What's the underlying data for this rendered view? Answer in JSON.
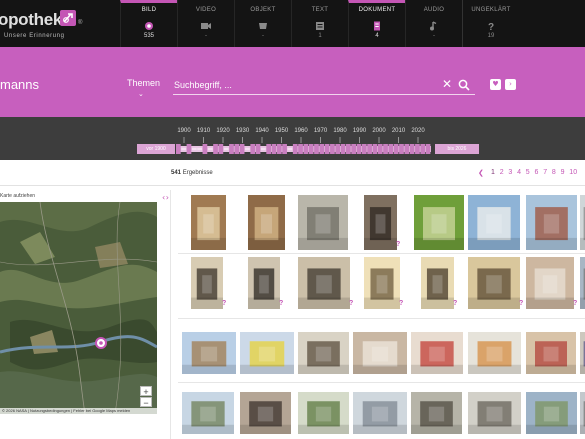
{
  "app": {
    "logo_text": "opothek",
    "logo_tagline": "Unsere Erinnerung",
    "logo_registered": "®"
  },
  "nav": {
    "tabs": [
      {
        "label": "BILD",
        "count": "535",
        "icon": "camera-icon",
        "active": true
      },
      {
        "label": "VIDEO",
        "count": "-",
        "icon": "video-icon",
        "active": false
      },
      {
        "label": "OBJEKT",
        "count": "-",
        "icon": "object-icon",
        "active": false
      },
      {
        "label": "TEXT",
        "count": "1",
        "icon": "text-icon",
        "active": false
      },
      {
        "label": "DOKUMENT",
        "count": "4",
        "icon": "document-icon",
        "active": true
      },
      {
        "label": "AUDIO",
        "count": "-",
        "icon": "audio-icon",
        "active": false
      },
      {
        "label": "UNGEKLÄRT",
        "count": "19",
        "icon": "question-icon",
        "active": false
      }
    ]
  },
  "search": {
    "band_title": "manns",
    "themen_label": "Themen",
    "themen_chevron": "⌄",
    "placeholder": "Suchbegriff, ...",
    "value": "",
    "clear_glyph": "✕",
    "heart_glyph": "♥",
    "extra_glyph": "›"
  },
  "timeline": {
    "years": [
      "1900",
      "1910",
      "1920",
      "1930",
      "1940",
      "1950",
      "1960",
      "1970",
      "1980",
      "1990",
      "2000",
      "2010",
      "2020"
    ],
    "from_label": "vor 1900",
    "to_label": "bis 2026",
    "density": [
      1,
      0,
      1,
      0,
      0,
      1,
      0,
      1,
      1,
      0,
      1,
      1,
      1,
      0,
      1,
      1,
      0,
      1,
      1,
      1,
      1,
      0,
      1,
      1,
      1,
      1,
      1,
      1,
      1,
      1,
      1,
      1,
      1,
      1,
      1,
      1,
      1,
      1,
      1,
      1,
      1,
      1,
      1,
      1,
      1,
      1,
      1,
      1
    ]
  },
  "results": {
    "count": "541",
    "count_label": "Ergebnisse",
    "pager": {
      "prev": "❮",
      "pages": [
        "1",
        "2",
        "3",
        "4",
        "5",
        "6",
        "7",
        "8",
        "9",
        "10"
      ],
      "next": "❯",
      "current": "1"
    },
    "split_control": "‹ ›",
    "map_label": "Karte aufziehen",
    "map_attribution": "© 2026 NASA | Nutzungsbedingungen | Fehler bei Google Maps melden",
    "zoom_in": "+",
    "zoom_out": "−",
    "rows": [
      {
        "items": [
          {
            "name": "photo-altar-1",
            "bg": "#a07a52",
            "accent": "#e7d3a8",
            "q": false
          },
          {
            "name": "photo-altar-2",
            "bg": "#8f6b48",
            "accent": "#d8b98a",
            "q": false
          },
          {
            "name": "photo-map-sketch",
            "bg": "#b9b6aa",
            "accent": "#6f6c63",
            "q": false
          },
          {
            "name": "photo-portrait-priest",
            "bg": "#7f7060",
            "accent": "#2c2620",
            "q": true
          },
          {
            "name": "photo-postcard-collage",
            "bg": "#6f9f3a",
            "accent": "#cfd8a0",
            "q": false
          },
          {
            "name": "photo-building-blue",
            "bg": "#8eb3d6",
            "accent": "#f2f2ee",
            "q": false
          },
          {
            "name": "photo-brick-building",
            "bg": "#a9c4dc",
            "accent": "#a0533b",
            "q": false
          },
          {
            "name": "photo-clip",
            "bg": "#cfd6d8",
            "accent": "#888",
            "q": false
          }
        ]
      },
      {
        "items": [
          {
            "name": "photo-portrait-man",
            "bg": "#d8ccb3",
            "accent": "#3a3228",
            "q": true
          },
          {
            "name": "photo-couple",
            "bg": "#cfc4b0",
            "accent": "#2a2520",
            "q": true
          },
          {
            "name": "photo-group",
            "bg": "#cbbfa8",
            "accent": "#3c352c",
            "q": true
          },
          {
            "name": "photo-framed",
            "bg": "#efe0b8",
            "accent": "#6b5a3c",
            "q": true
          },
          {
            "name": "photo-framed-portrait",
            "bg": "#e9dbb4",
            "accent": "#463a2a",
            "q": true
          },
          {
            "name": "photo-school-group",
            "bg": "#d9c79c",
            "accent": "#5a4a33",
            "q": true
          },
          {
            "name": "photo-town-view",
            "bg": "#cdb7a0",
            "accent": "#e8e0d6",
            "q": true
          },
          {
            "name": "photo-clip-2",
            "bg": "#a8b6c4",
            "accent": "#777",
            "q": false
          }
        ]
      },
      {
        "items": [
          {
            "name": "photo-street",
            "bg": "#b9cfe6",
            "accent": "#a17c4f",
            "q": false
          },
          {
            "name": "photo-yard",
            "bg": "#ccd9e8",
            "accent": "#e8d13a",
            "q": false
          },
          {
            "name": "photo-hall",
            "bg": "#d9d3c5",
            "accent": "#5a4d3c",
            "q": false
          },
          {
            "name": "photo-classroom",
            "bg": "#c9b7a3",
            "accent": "#eee7dc",
            "q": false
          },
          {
            "name": "photo-room-red",
            "bg": "#e8dcd0",
            "accent": "#c33f37",
            "q": false
          },
          {
            "name": "photo-room-bright",
            "bg": "#e6e3da",
            "accent": "#d68d43",
            "q": false
          },
          {
            "name": "photo-kids-table",
            "bg": "#d8c3a8",
            "accent": "#b3433b",
            "q": false
          },
          {
            "name": "photo-people-group",
            "bg": "#cdc8be",
            "accent": "#5d5a8a",
            "q": false
          }
        ]
      },
      {
        "items": [
          {
            "name": "photo-village",
            "bg": "#c7d6e4",
            "accent": "#6f7f57",
            "q": false
          },
          {
            "name": "photo-ceremony",
            "bg": "#b4a595",
            "accent": "#3b322c",
            "q": false
          },
          {
            "name": "photo-model",
            "bg": "#d5dbc9",
            "accent": "#5c7a40",
            "q": false
          },
          {
            "name": "photo-street-old",
            "bg": "#cfd7dd",
            "accent": "#7f8892",
            "q": false
          },
          {
            "name": "photo-procession",
            "bg": "#b6b4a8",
            "accent": "#4f4b40",
            "q": false
          },
          {
            "name": "photo-houses",
            "bg": "#d2d0c8",
            "accent": "#67635a",
            "q": false
          },
          {
            "name": "photo-aerial",
            "bg": "#9db3c7",
            "accent": "#7e9460",
            "q": false
          },
          {
            "name": "photo-clip-3",
            "bg": "#c3c8cc",
            "accent": "#777",
            "q": false
          }
        ]
      }
    ]
  }
}
